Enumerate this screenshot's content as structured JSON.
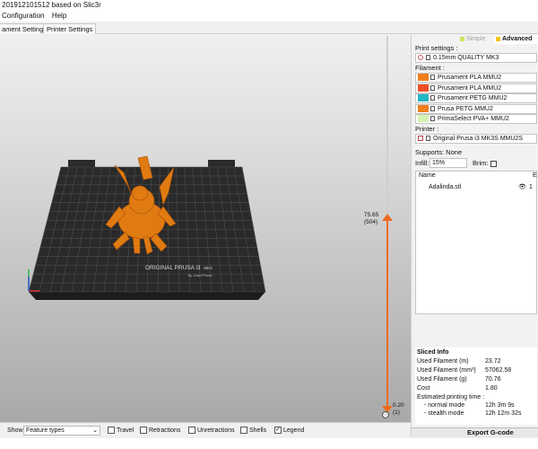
{
  "window": {
    "title": "201912101512 based on Slic3r"
  },
  "menu": {
    "items": [
      "Configuration",
      "Help"
    ]
  },
  "tabs": {
    "print_settings": "ament Settings",
    "printer_settings": "Printer Settings"
  },
  "modes": {
    "simple": "Simple",
    "advanced": "Advanced",
    "active": "Advanced"
  },
  "sidebar": {
    "print_settings_label": "Print settings :",
    "print_profile": "0.15mm QUALITY MK3",
    "filament_label": "Filament :",
    "filaments": [
      {
        "name": "Prusament PLA MMU2",
        "color": "#f07f1d"
      },
      {
        "name": "Prusament PLA MMU2",
        "color": "#ee4f26"
      },
      {
        "name": "Prusament PETG MMU2",
        "color": "#22b6c8"
      },
      {
        "name": "Prusa PETG MMU2",
        "color": "#f07f1d"
      },
      {
        "name": "PrimaSelect PVA+ MMU2",
        "color": "#d5f2b2"
      }
    ],
    "printer_label": "Printer :",
    "printer_profile": "Original Prusa i3 MK3S MMU2S",
    "supports_label": "Supports: None",
    "infill_label": "Infill:",
    "infill_value": "15%",
    "brim_label": "Brim:",
    "objects_header": {
      "name": "Name",
      "extruder": "E"
    },
    "objects": [
      {
        "name": "Adalinda.stl",
        "extruder": "1"
      }
    ]
  },
  "sliced_info": {
    "title": "Sliced Info",
    "rows": [
      {
        "label": "Used Filament (m)",
        "value": "23.72"
      },
      {
        "label": "Used Filament (mm³)",
        "value": "57062.58"
      },
      {
        "label": "Used Filament (g)",
        "value": "70.76"
      },
      {
        "label": "Cost",
        "value": "1.80"
      }
    ],
    "time_label": "Estimated printing time :",
    "times": [
      {
        "label": "- normal mode",
        "value": "12h 3m 9s"
      },
      {
        "label": "- stealth mode",
        "value": "12h 12m 32s"
      }
    ]
  },
  "export_label": "Export G-code",
  "layer_slider": {
    "top_value": "75.65",
    "top_layer": "(504)",
    "bottom_value": "0.20",
    "bottom_layer": "(1)",
    "top_fraction": 1.0,
    "bottom_fraction": 0.0
  },
  "bed": {
    "brand": "ORIGINAL PRUSA i3",
    "model": "MK3",
    "by": "by Josef Prusa"
  },
  "bottom_bar": {
    "show_label": "Show",
    "view_select": "Feature types",
    "toggles": [
      {
        "label": "Travel",
        "checked": false
      },
      {
        "label": "Retractions",
        "checked": false
      },
      {
        "label": "Unretractions",
        "checked": false
      },
      {
        "label": "Shells",
        "checked": false
      },
      {
        "label": "Legend",
        "checked": true
      }
    ]
  },
  "colors": {
    "accent": "#ed6b21",
    "model": "#e07b12"
  }
}
